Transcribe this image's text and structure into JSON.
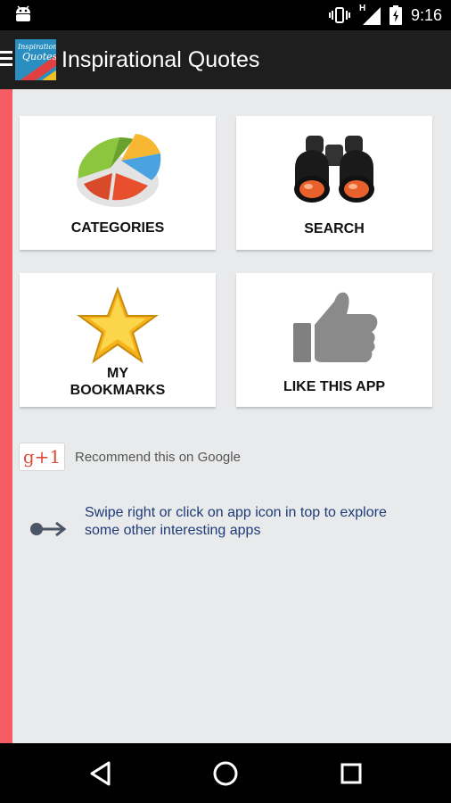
{
  "status_bar": {
    "time": "9:16",
    "network_label": "H",
    "icons": [
      "android-icon",
      "vibrate-icon",
      "signal-icon",
      "battery-icon"
    ]
  },
  "app_bar": {
    "title": "Inspirational Quotes",
    "icon_text_top": "Inspirational",
    "icon_text_bottom": "Quotes"
  },
  "tiles": [
    {
      "label": "CATEGORIES",
      "icon": "pie-chart-icon"
    },
    {
      "label": "SEARCH",
      "icon": "binoculars-icon"
    },
    {
      "label_line1": "MY",
      "label_line2": "BOOKMARKS",
      "icon": "star-icon"
    },
    {
      "label": "LIKE THIS APP",
      "icon": "thumbs-up-icon"
    }
  ],
  "google_plus": {
    "button_text": "g+1",
    "text": "Recommend this on Google"
  },
  "swipe_hint": {
    "line1": "Swipe right or click on app icon in top to explore",
    "line2": "some other interesting apps"
  },
  "colors": {
    "left_strip": "#f45b62",
    "app_bar": "#1e1e1e",
    "content_bg": "#e9eaeb",
    "hint_text": "#1c3b78"
  },
  "nav_bar": {
    "buttons": [
      "back-icon",
      "home-icon",
      "recents-icon"
    ]
  }
}
